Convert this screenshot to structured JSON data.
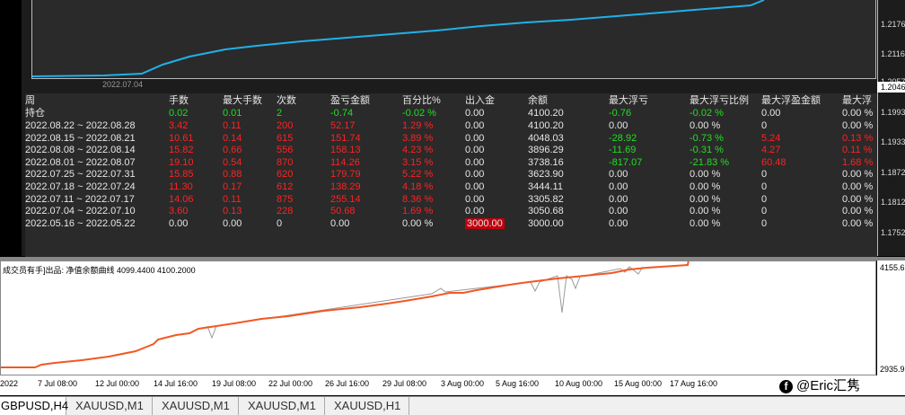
{
  "top_panel": {
    "axis_labels": [
      "1.2176",
      "1.2116",
      "1.2057",
      "1.1993",
      "1.1933",
      "1.1872",
      "1.1812",
      "1.1752"
    ],
    "current_price": "1.2046",
    "date_label": "2022.07.04"
  },
  "stats_table": {
    "headers": [
      "周",
      "手数",
      "最大手数",
      "次数",
      "盈亏金额",
      "百分比%",
      "出入金",
      "余额",
      "最大浮亏",
      "最大浮亏比例",
      "最大浮盈金额",
      "最大浮"
    ],
    "position_row": [
      "持仓",
      "0.02",
      "0.01",
      "2",
      "-0.74",
      "-0.02 %",
      "0.00",
      "4100.20",
      "-0.76",
      "-0.02 %",
      "0.00",
      "0.00 %"
    ],
    "rows": [
      [
        "2022.08.22 ~ 2022.08.28",
        "3.42",
        "0.11",
        "200",
        "52.17",
        "1.29 %",
        "0.00",
        "4100.20",
        "0.00",
        "0.00 %",
        "0",
        "0.00 %"
      ],
      [
        "2022.08.15 ~ 2022.08.21",
        "10.61",
        "0.14",
        "615",
        "151.74",
        "3.89 %",
        "0.00",
        "4048.03",
        "-28.92",
        "-0.73 %",
        "5.24",
        "0.13 %"
      ],
      [
        "2022.08.08 ~ 2022.08.14",
        "15.82",
        "0.66",
        "556",
        "158.13",
        "4.23 %",
        "0.00",
        "3896.29",
        "-11.69",
        "-0.31 %",
        "4.27",
        "0.11 %"
      ],
      [
        "2022.08.01 ~ 2022.08.07",
        "19.10",
        "0.54",
        "870",
        "114.26",
        "3.15 %",
        "0.00",
        "3738.16",
        "-817.07",
        "-21.83 %",
        "60.48",
        "1.68 %"
      ],
      [
        "2022.07.25 ~ 2022.07.31",
        "15.85",
        "0.88",
        "620",
        "179.79",
        "5.22 %",
        "0.00",
        "3623.90",
        "0.00",
        "0.00 %",
        "0",
        "0.00 %"
      ],
      [
        "2022.07.18 ~ 2022.07.24",
        "11.30",
        "0.17",
        "612",
        "138.29",
        "4.18 %",
        "0.00",
        "3444.11",
        "0.00",
        "0.00 %",
        "0",
        "0.00 %"
      ],
      [
        "2022.07.11 ~ 2022.07.17",
        "14.06",
        "0.11",
        "875",
        "255.14",
        "8.36 %",
        "0.00",
        "3305.82",
        "0.00",
        "0.00 %",
        "0",
        "0.00 %"
      ],
      [
        "2022.07.04 ~ 2022.07.10",
        "3.60",
        "0.13",
        "228",
        "50.68",
        "1.69 %",
        "0.00",
        "3050.68",
        "0.00",
        "0.00 %",
        "0",
        "0.00 %"
      ],
      [
        "2022.05.16 ~ 2022.05.22",
        "0.00",
        "0.00",
        "0",
        "0.00",
        "0.00 %",
        "3000.00",
        "3000.00",
        "0.00",
        "0.00 %",
        "0",
        "0.00 %"
      ]
    ]
  },
  "indicator": {
    "title": "成交员有手]出品: 净值余额曲线 4099.4400 4100.2000",
    "axis_top": "4155.6",
    "axis_bottom": "2935.9"
  },
  "x_axis_labels": [
    "2022",
    "7 Jul 08:00",
    "12 Jul 00:00",
    "14 Jul 16:00",
    "19 Jul 08:00",
    "22 Jul 00:00",
    "26 Jul 16:00",
    "29 Jul 08:00",
    "3 Aug 00:00",
    "5 Aug 16:00",
    "10 Aug 00:00",
    "15 Aug 00:00",
    "17 Aug 16:00"
  ],
  "watermark": "@Eric汇隽",
  "tabs": [
    "GBPUSD,H4",
    "XAUUSD,M1",
    "XAUUSD,M1",
    "XAUUSD,M1",
    "XAUUSD,H1"
  ]
}
